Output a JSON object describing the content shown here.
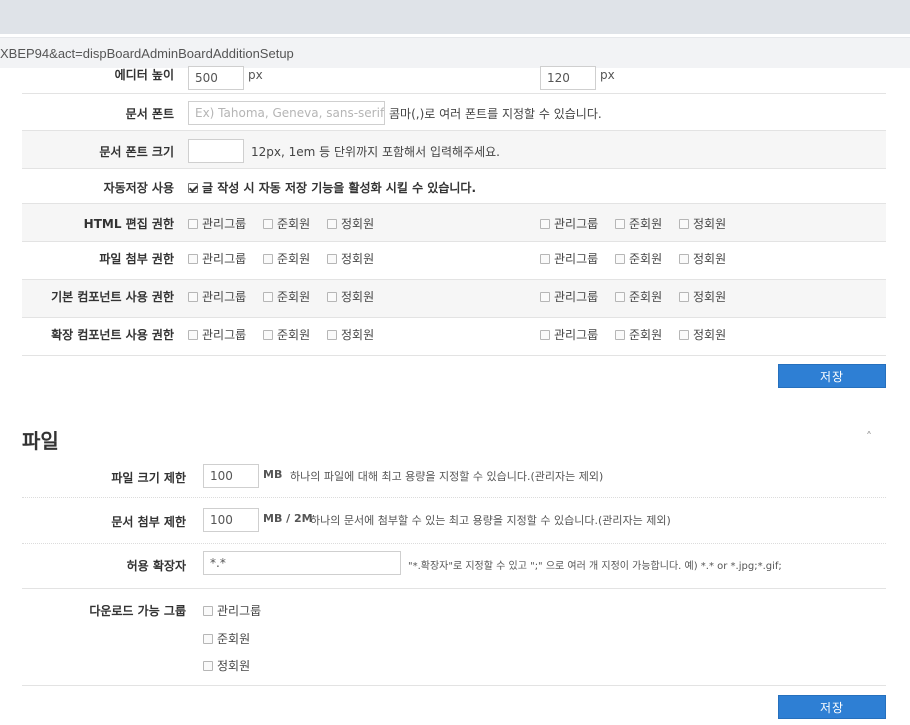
{
  "browser": {
    "url_fragment": "XBEP94&act=dispBoardAdminBoardAdditionSetup"
  },
  "editor_height": {
    "label": "에디터 높이",
    "value1": "500",
    "unit1": "px",
    "value2": "120",
    "unit2": "px"
  },
  "doc_font": {
    "label": "문서 폰트",
    "placeholder": "Ex) Tahoma, Geneva, sans-serif",
    "help": "콤마(,)로 여러 폰트를 지정할 수 있습니다."
  },
  "doc_font_size": {
    "label": "문서 폰트 크기",
    "value": "",
    "help": "12px, 1em 등 단위까지 포함해서 입력해주세요."
  },
  "autosave": {
    "label": "자동저장 사용",
    "checked": true,
    "text": "글 작성 시 자동 저장 기능을 활성화 시킬 수 있습니다."
  },
  "groups": {
    "admin": "관리그룹",
    "associate": "준회원",
    "regular": "정회원"
  },
  "permissions": [
    {
      "label": "HTML 편집 권한"
    },
    {
      "label": "파일 첨부 권한"
    },
    {
      "label": "기본 컴포넌트 사용 권한"
    },
    {
      "label": "확장 컴포넌트 사용 권한"
    }
  ],
  "save_label": "저장",
  "file_section": {
    "title": "파일",
    "collapse_icon": "chevron-up-icon",
    "size_limit": {
      "label": "파일 크기 제한",
      "value": "100",
      "unit": "MB",
      "help": "하나의 파일에 대해 최고 용량을 지정할 수 있습니다.(관리자는 제외)"
    },
    "attach_limit": {
      "label": "문서 첨부 제한",
      "value": "100",
      "unit": "MB / 2M",
      "help": "하나의 문서에 첨부할 수 있는 최고 용량을 지정할 수 있습니다.(관리자는 제외)"
    },
    "allowed_ext": {
      "label": "허용 확장자",
      "value": "*.*",
      "help": "\"*.확장자\"로 지정할 수 있고 \";\" 으로 여러 개 지정이 가능합니다. 예) *.* or *.jpg;*.gif;"
    },
    "download_group": {
      "label": "다운로드 가능 그룹"
    }
  },
  "colors": {
    "accent": "#2e7fd4",
    "row_shade": "#f6f6f6"
  }
}
